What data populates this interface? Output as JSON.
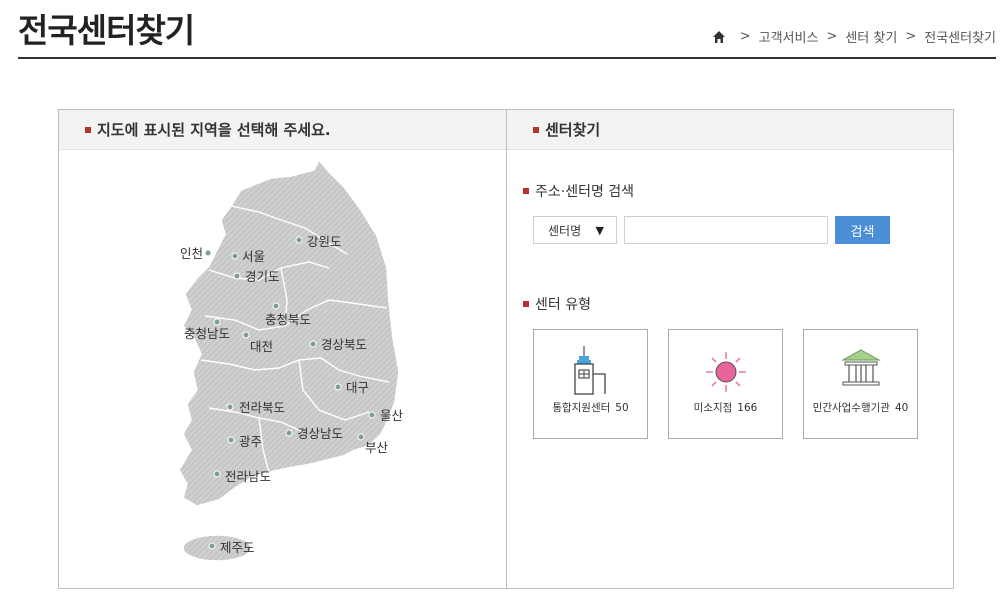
{
  "header": {
    "title": "전국센터찾기",
    "breadcrumb": [
      "고객서비스",
      "센터 찾기",
      "전국센터찾기"
    ],
    "separator": ">"
  },
  "map_panel": {
    "title": "지도에 표시된 지역을 선택해 주세요.",
    "regions": [
      {
        "name": "인천"
      },
      {
        "name": "서울"
      },
      {
        "name": "경기도"
      },
      {
        "name": "강원도"
      },
      {
        "name": "충청북도"
      },
      {
        "name": "충청남도"
      },
      {
        "name": "대전"
      },
      {
        "name": "경상북도"
      },
      {
        "name": "대구"
      },
      {
        "name": "전라북도"
      },
      {
        "name": "울산"
      },
      {
        "name": "경상남도"
      },
      {
        "name": "광주"
      },
      {
        "name": "부산"
      },
      {
        "name": "전라남도"
      },
      {
        "name": "제주도"
      }
    ]
  },
  "finder_panel": {
    "title": "센터찾기",
    "search_section_title": "주소·센터명 검색",
    "select_value": "센터명",
    "search_input_value": "",
    "search_button_label": "검색",
    "type_section_title": "센터 유형",
    "types": [
      {
        "label": "통합지원센터",
        "count": "50",
        "icon": "building-icon"
      },
      {
        "label": "미소지점",
        "count": "166",
        "icon": "sun-icon"
      },
      {
        "label": "민간사업수행기관",
        "count": "40",
        "icon": "bank-icon"
      }
    ]
  },
  "colors": {
    "accent_bullet": "#b5332e",
    "search_button": "#4a8fd8",
    "map_fill": "#c9c9c9",
    "sun_fill": "#e8649a",
    "bank_fill": "#a8d08d"
  }
}
